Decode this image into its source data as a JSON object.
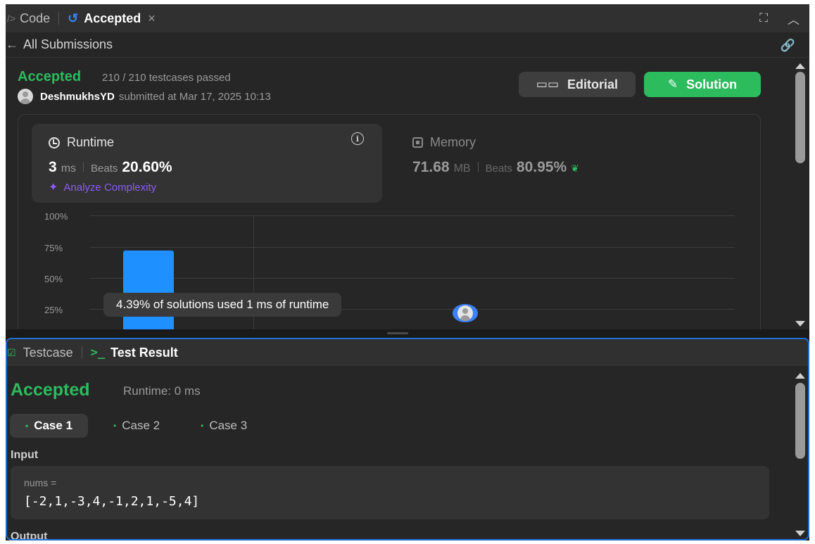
{
  "tabs": {
    "code_label": "Code",
    "accepted_label": "Accepted",
    "close_glyph": "×"
  },
  "subbar": {
    "label": "All Submissions"
  },
  "submission": {
    "status": "Accepted",
    "tests": "210 / 210 testcases passed",
    "user": "DeshmukhsYD",
    "submitted_text": "submitted at Mar 17, 2025 10:13"
  },
  "buttons": {
    "editorial": "Editorial",
    "solution": "Solution"
  },
  "runtime": {
    "title": "Runtime",
    "value": "3",
    "unit": "ms",
    "beats_label": "Beats",
    "beats_value": "20.60%",
    "analyze": "Analyze Complexity"
  },
  "memory": {
    "title": "Memory",
    "value": "71.68",
    "unit": "MB",
    "beats_label": "Beats",
    "beats_value": "80.95%"
  },
  "chart_data": {
    "type": "bar",
    "y_ticks": [
      "100%",
      "75%",
      "50%",
      "25%"
    ],
    "ylim": [
      0,
      100
    ],
    "bars": [
      {
        "value": 72
      }
    ],
    "grid": true,
    "tooltip": "4.39% of solutions used 1 ms of runtime"
  },
  "test_panel": {
    "testcase_label": "Testcase",
    "result_label": "Test Result",
    "status": "Accepted",
    "runtime_text": "Runtime: 0 ms",
    "cases": [
      "Case 1",
      "Case 2",
      "Case 3"
    ],
    "input_label": "Input",
    "var_name": "nums =",
    "var_value": "[-2,1,-3,4,-1,2,1,-5,4]",
    "output_label": "Output"
  },
  "colors": {
    "accent_green": "#2cbb5d",
    "accent_blue": "#1e90ff",
    "panel_bg": "#262626",
    "focus_border": "#1e6fd9"
  }
}
